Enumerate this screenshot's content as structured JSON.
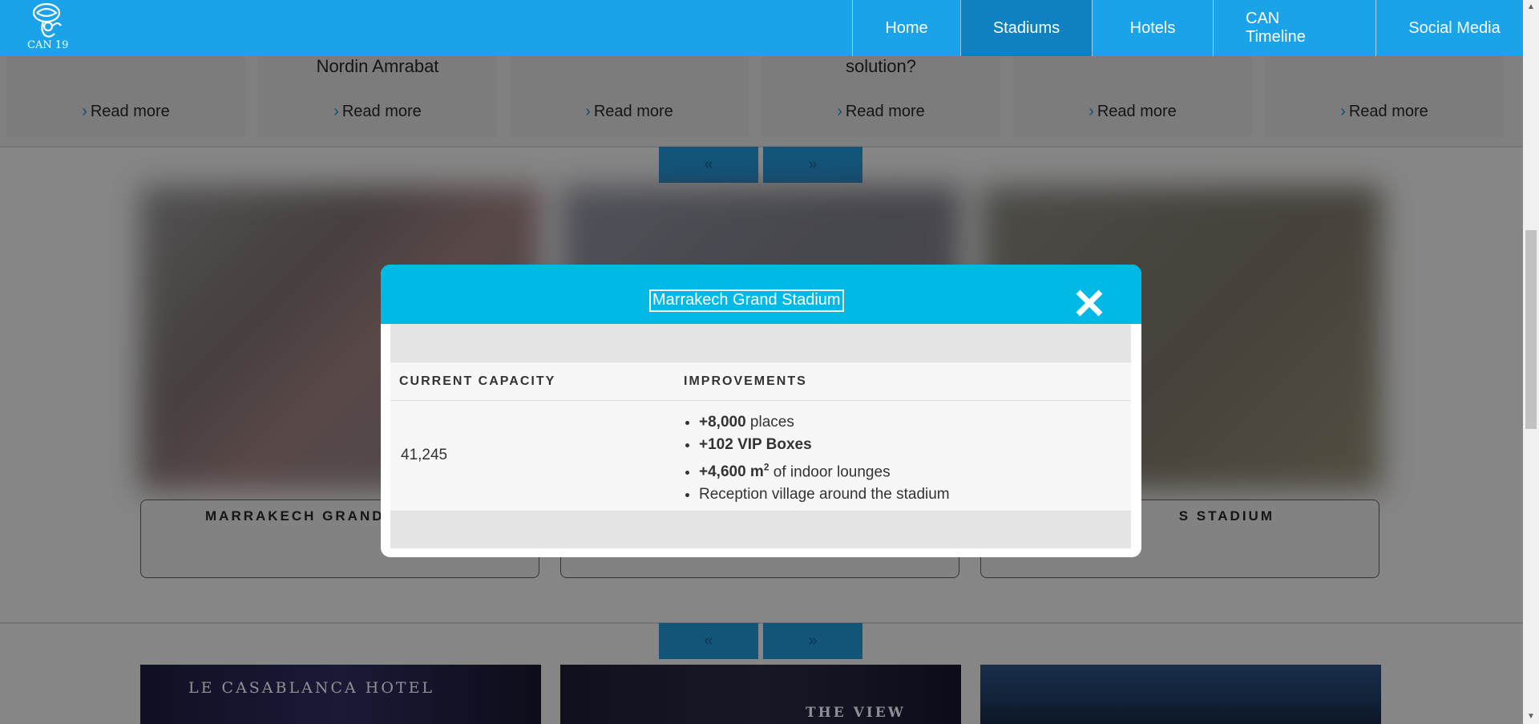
{
  "nav": {
    "logo_text": "CAN 19",
    "items": [
      {
        "label": "Home"
      },
      {
        "label": "Stadiums"
      },
      {
        "label": "Hotels"
      },
      {
        "label": "CAN Timeline"
      },
      {
        "label": "Social Media"
      }
    ],
    "active_index": 1
  },
  "news": {
    "titles": [
      "",
      "Nordin Amrabat",
      "",
      "solution?",
      "",
      ""
    ],
    "read_more": "Read more"
  },
  "pager": {
    "prev": "«",
    "next": "»"
  },
  "stadiums": {
    "cards": [
      "MARRAKECH GRAND",
      "",
      "S STADIUM"
    ]
  },
  "hotels": {
    "labels": [
      "LE CASABLANCA HOTEL",
      "THE VIEW",
      ""
    ]
  },
  "modal": {
    "title": "Marrakech Grand Stadium",
    "headers": {
      "capacity": "CURRENT CAPACITY",
      "improvements": "IMPROVEMENTS"
    },
    "capacity": "41,245",
    "improvements": [
      {
        "bold": "+8,000",
        "text": " places"
      },
      {
        "bold": "+102 VIP Boxes",
        "text": ""
      },
      {
        "bold": "+4,600 m",
        "sup": "2",
        "text": " of indoor lounges"
      },
      {
        "bold": "",
        "text": "Reception village around the stadium"
      }
    ]
  },
  "colors": {
    "navbar": "#1aa3e8",
    "nav_active": "#0f80c0",
    "modal_header": "#00bae5"
  }
}
